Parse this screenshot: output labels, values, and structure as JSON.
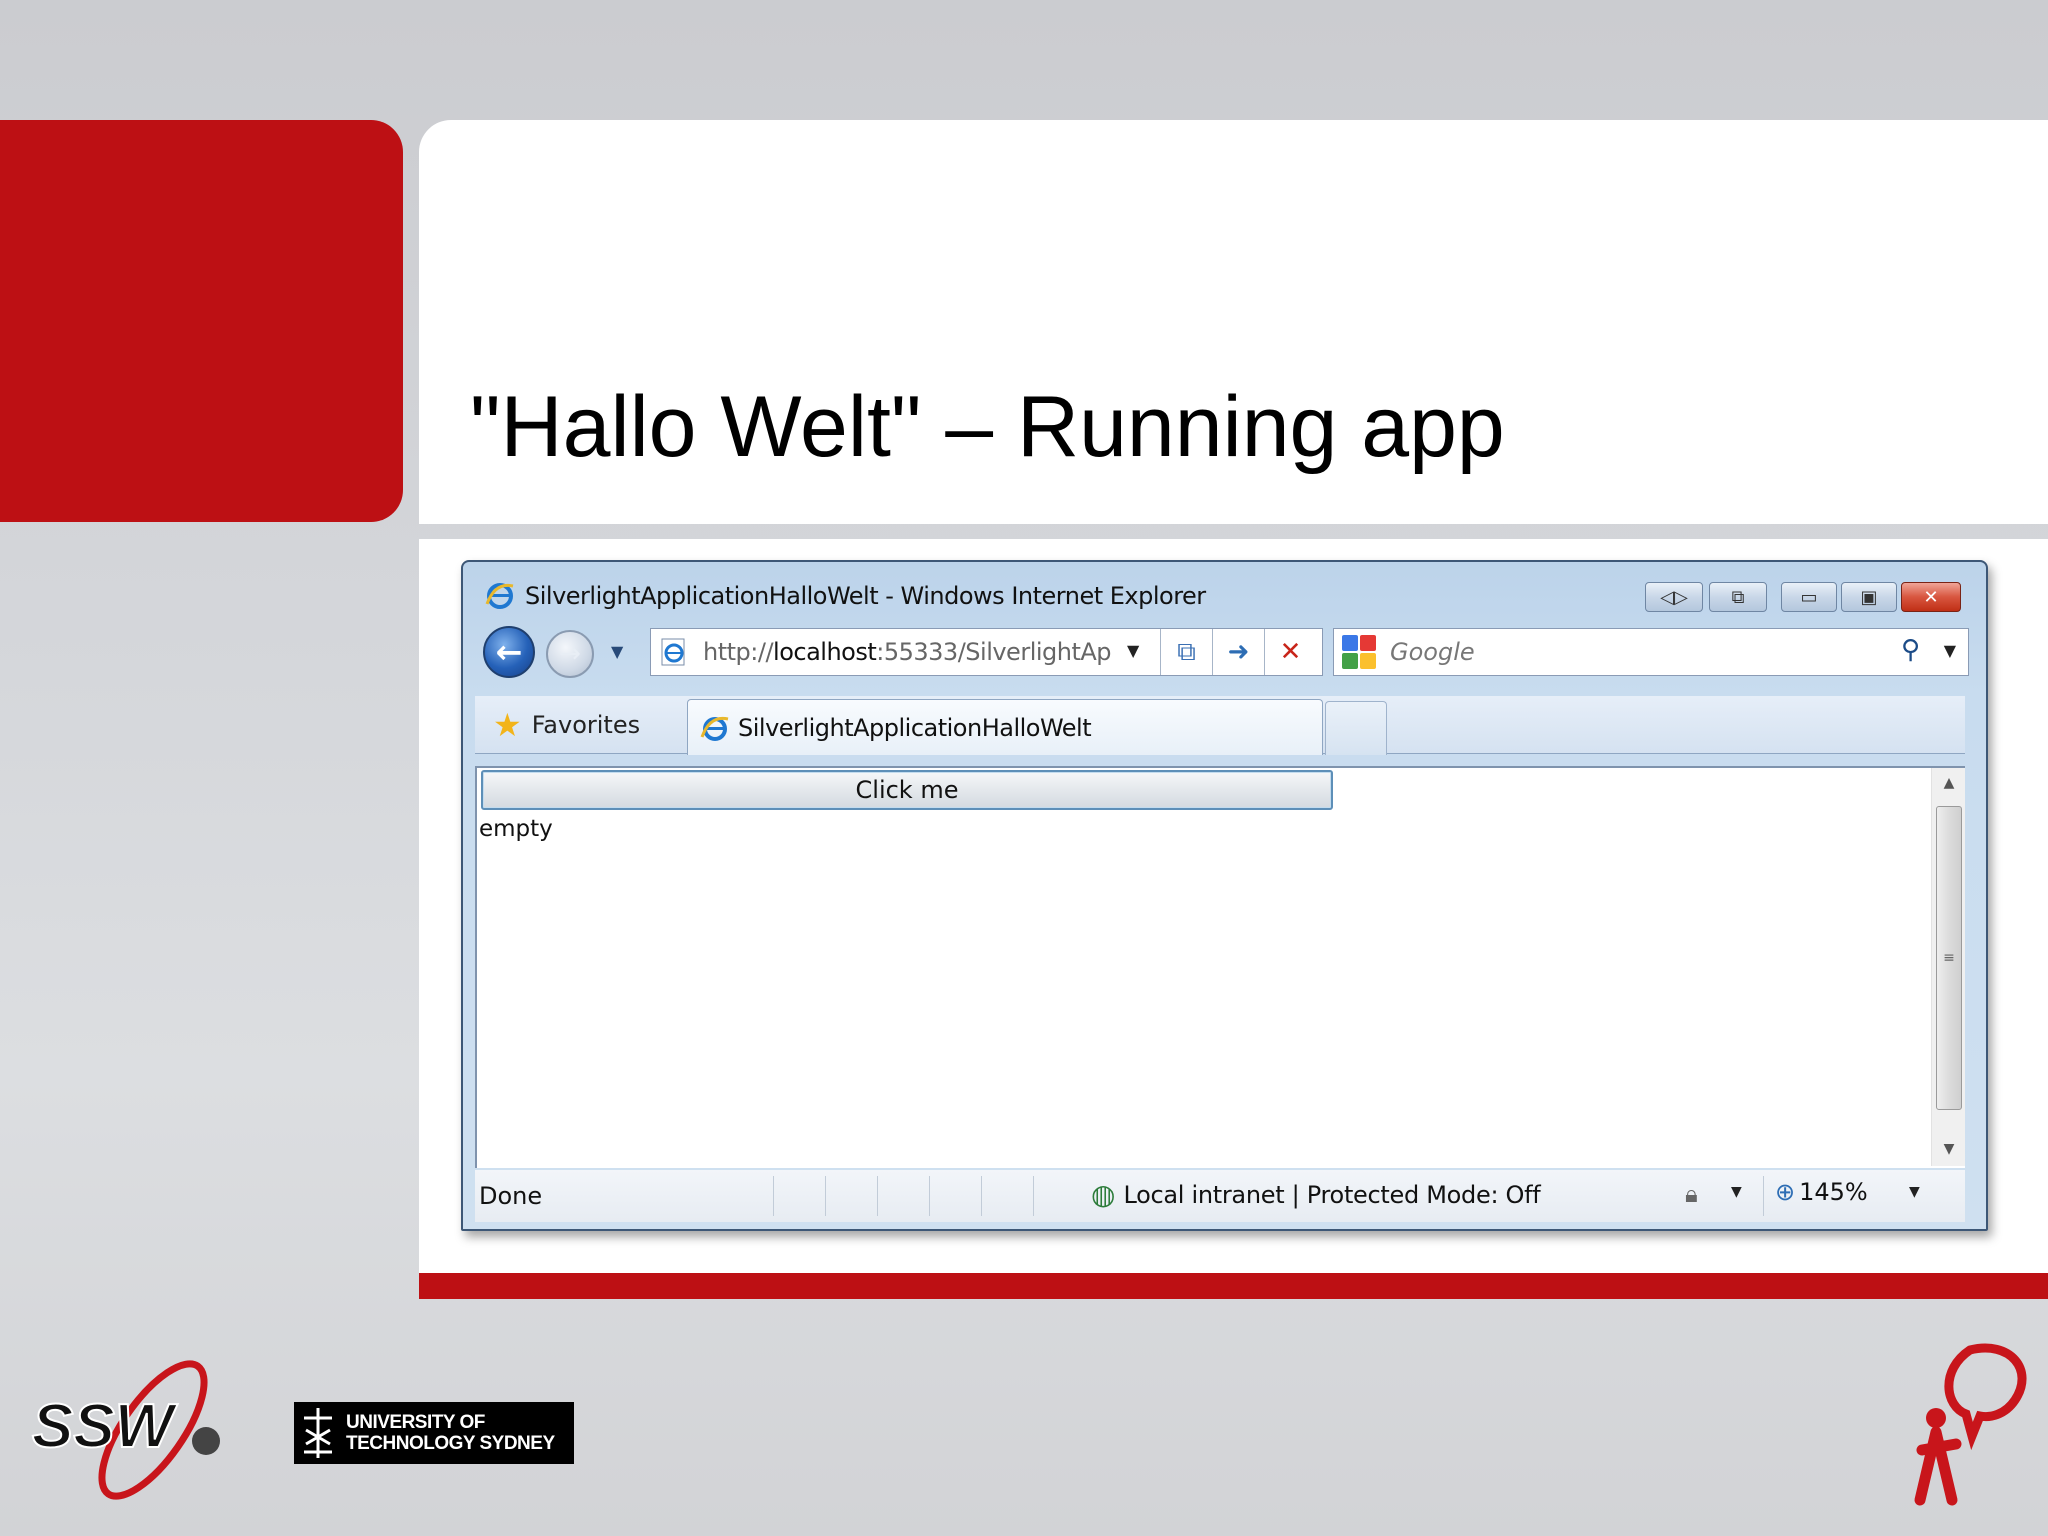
{
  "slide": {
    "title": "\"Hallo Welt\" – Running app"
  },
  "browser": {
    "window_title": "SilverlightApplicationHalloWelt - Windows Internet Explorer",
    "address": {
      "prefix": "http://",
      "host": "localhost",
      "rest": ":55333/SilverlightApp"
    },
    "search_placeholder": "Google",
    "favorites_label": "Favorites",
    "tab_label": "SilverlightApplicationHalloWelt",
    "page": {
      "button_label": "Click me",
      "output_text": "empty"
    },
    "status": {
      "done": "Done",
      "zone": "Local intranet | Protected Mode: Off",
      "zoom": "145%"
    },
    "colors": {
      "accent_red": "#bd1014",
      "frame_blue": "#c8dcef"
    }
  },
  "footer": {
    "ssw_logo": "SSW",
    "uts_logo_line1": "UNIVERSITY OF",
    "uts_logo_line2": "TECHNOLOGY SYDNEY"
  },
  "icons": [
    "ie-icon",
    "back-arrow-icon",
    "forward-arrow-icon",
    "compat-view-icon",
    "refresh-arrow-icon",
    "stop-x-icon",
    "google-icon",
    "search-icon",
    "star-icon",
    "globe-zone-icon",
    "lock-icon",
    "zoom-icon"
  ]
}
